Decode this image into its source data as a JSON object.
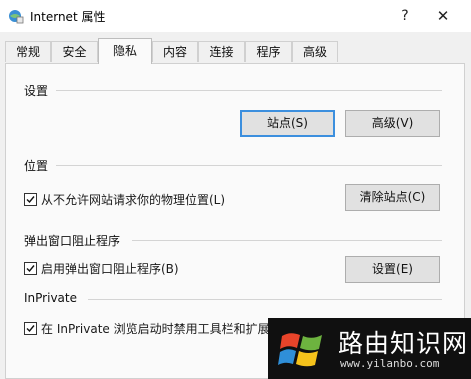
{
  "window": {
    "title": "Internet 属性",
    "help_glyph": "?",
    "close_glyph": "✕"
  },
  "tabs": [
    {
      "label": "常规",
      "active": false
    },
    {
      "label": "安全",
      "active": false
    },
    {
      "label": "隐私",
      "active": true
    },
    {
      "label": "内容",
      "active": false
    },
    {
      "label": "连接",
      "active": false
    },
    {
      "label": "程序",
      "active": false
    },
    {
      "label": "高级",
      "active": false
    }
  ],
  "settings": {
    "label": "设置",
    "sites_button": "站点(S)",
    "advanced_button": "高级(V)"
  },
  "location": {
    "label": "位置",
    "checkbox_label": "从不允许网站请求你的物理位置(L)",
    "checked": true,
    "clear_button": "清除站点(C)"
  },
  "popup": {
    "label": "弹出窗口阻止程序",
    "checkbox_label": "启用弹出窗口阻止程序(B)",
    "checked": true,
    "settings_button": "设置(E)"
  },
  "inprivate": {
    "label": "InPrivate",
    "checkbox_label": "在 InPrivate 浏览启动时禁用工具栏和扩展(T)",
    "checked": true
  },
  "watermark": {
    "title": "路由知识网",
    "url": "www.yilanbo.com"
  },
  "colors": {
    "default_button_border": "#3c8fde",
    "panel": "#fafafa",
    "window": "#f0f0f0"
  }
}
